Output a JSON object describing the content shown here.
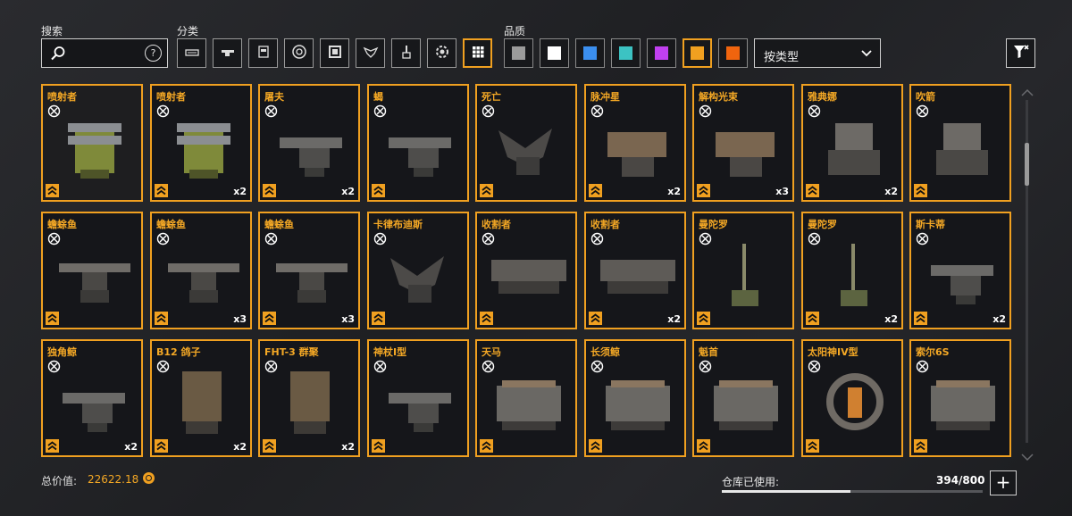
{
  "search": {
    "label": "搜索",
    "value": "",
    "help_text": "?"
  },
  "category": {
    "label": "分类",
    "icons": [
      "car-body-icon",
      "cannon-icon",
      "cabin-icon",
      "wheel-icon",
      "frame-icon",
      "emblem-icon",
      "paint-brush-icon",
      "gear-module-icon",
      "grid-all-icon"
    ],
    "active_index": 8
  },
  "quality": {
    "label": "品质",
    "colors": [
      "#9b9b9b",
      "#ffffff",
      "#3b8ff0",
      "#3cc3c3",
      "#c040f0",
      "#f0a020",
      "#f0640e"
    ],
    "active_index": 5
  },
  "sort": {
    "value": "按类型"
  },
  "items": [
    {
      "name": "喷射者",
      "count": "",
      "art": "rocket"
    },
    {
      "name": "喷射者",
      "count": "x2",
      "art": "rocket"
    },
    {
      "name": "屠夫",
      "count": "x2",
      "art": "gun"
    },
    {
      "name": "蝎",
      "count": "",
      "art": "gun"
    },
    {
      "name": "死亡",
      "count": "",
      "art": "claw"
    },
    {
      "name": "脉冲星",
      "count": "x2",
      "art": "box"
    },
    {
      "name": "解构光束",
      "count": "x3",
      "art": "box"
    },
    {
      "name": "雅典娜",
      "count": "x2",
      "art": "turret"
    },
    {
      "name": "吹箭",
      "count": "",
      "art": "turret"
    },
    {
      "name": "蟾蜍鱼",
      "count": "",
      "art": "xbow"
    },
    {
      "name": "蟾蜍鱼",
      "count": "x3",
      "art": "xbow"
    },
    {
      "name": "蟾蜍鱼",
      "count": "x3",
      "art": "xbow"
    },
    {
      "name": "卡律布迪斯",
      "count": "",
      "art": "claw"
    },
    {
      "name": "收割者",
      "count": "",
      "art": "saw"
    },
    {
      "name": "收割者",
      "count": "x2",
      "art": "saw"
    },
    {
      "name": "曼陀罗",
      "count": "",
      "art": "pole"
    },
    {
      "name": "曼陀罗",
      "count": "x2",
      "art": "pole"
    },
    {
      "name": "斯卡蒂",
      "count": "x2",
      "art": "gun"
    },
    {
      "name": "独角鲸",
      "count": "x2",
      "art": "gun"
    },
    {
      "name": "B12 鸽子",
      "count": "x2",
      "art": "crate"
    },
    {
      "name": "FHT-3 群聚",
      "count": "x2",
      "art": "crate"
    },
    {
      "name": "神杖I型",
      "count": "",
      "art": "gun"
    },
    {
      "name": "天马",
      "count": "",
      "art": "engine"
    },
    {
      "name": "长须鲸",
      "count": "",
      "art": "engine"
    },
    {
      "name": "魁首",
      "count": "",
      "art": "engine"
    },
    {
      "name": "太阳神IV型",
      "count": "",
      "art": "ring"
    },
    {
      "name": "索尔6S",
      "count": "",
      "art": "engine"
    }
  ],
  "footer": {
    "total_label": "总价值:",
    "total_value": "22622.18",
    "warehouse_label": "仓库已使用:",
    "warehouse_value": "394/800",
    "warehouse_fraction": 0.4925,
    "add_label": "+"
  }
}
